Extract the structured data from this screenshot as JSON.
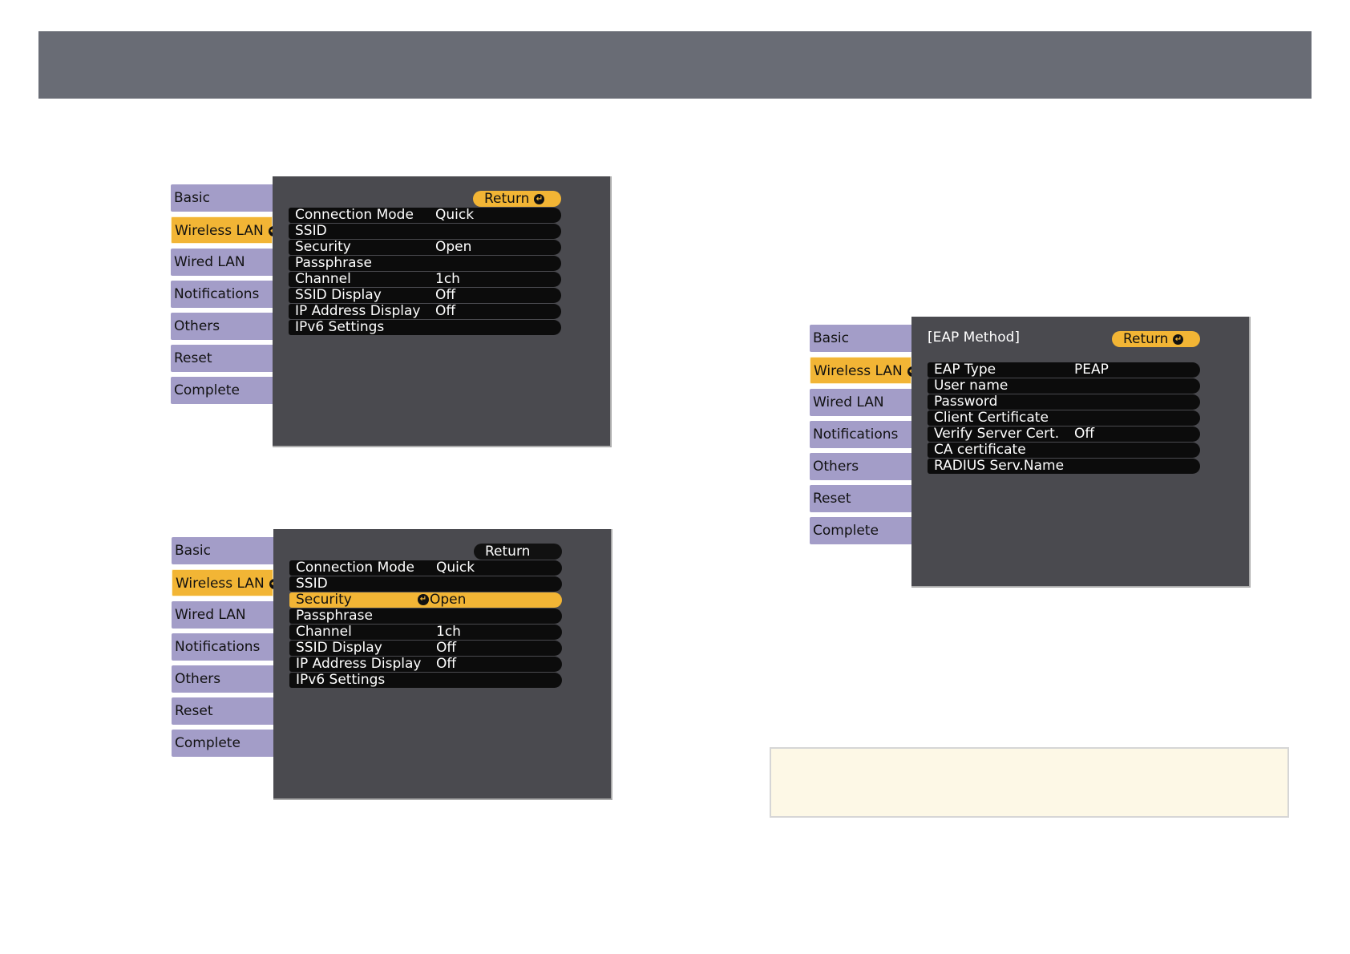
{
  "colors": {
    "banner": "#696c75",
    "tab_inactive": "#a39dc8",
    "tab_active": "#f2b535",
    "panel_bg": "#4a4a4f",
    "row_bg": "#0c0c0c",
    "note_bg": "#fdf8e6"
  },
  "tabs": [
    "Basic",
    "Wireless LAN",
    "Wired LAN",
    "Notifications",
    "Others",
    "Reset",
    "Complete"
  ],
  "active_tab": "Wireless LAN",
  "enter_icon": "enter-icon",
  "screen1": {
    "return_label": "Return",
    "rows": [
      {
        "label": "Connection Mode",
        "value": "Quick"
      },
      {
        "label": "SSID",
        "value": ""
      },
      {
        "label": "Security",
        "value": "Open"
      },
      {
        "label": "Passphrase",
        "value": ""
      },
      {
        "label": "Channel",
        "value": "1ch"
      },
      {
        "label": "SSID Display",
        "value": "Off"
      },
      {
        "label": "IP Address Display",
        "value": "Off"
      },
      {
        "label": "IPv6 Settings",
        "value": ""
      }
    ]
  },
  "screen2": {
    "return_label": "Return",
    "highlighted_row": "Security",
    "rows": [
      {
        "label": "Connection Mode",
        "value": "Quick"
      },
      {
        "label": "SSID",
        "value": ""
      },
      {
        "label": "Security",
        "value": "Open"
      },
      {
        "label": "Passphrase",
        "value": ""
      },
      {
        "label": "Channel",
        "value": "1ch"
      },
      {
        "label": "SSID Display",
        "value": "Off"
      },
      {
        "label": "IP Address Display",
        "value": "Off"
      },
      {
        "label": "IPv6 Settings",
        "value": ""
      }
    ]
  },
  "screen3": {
    "title": "[EAP Method]",
    "return_label": "Return",
    "rows": [
      {
        "label": "EAP Type",
        "value": "PEAP"
      },
      {
        "label": "User name",
        "value": ""
      },
      {
        "label": "Password",
        "value": ""
      },
      {
        "label": "Client Certificate",
        "value": ""
      },
      {
        "label": "Verify Server Cert.",
        "value": "Off"
      },
      {
        "label": "CA certificate",
        "value": ""
      },
      {
        "label": "RADIUS Serv.Name",
        "value": ""
      }
    ]
  }
}
